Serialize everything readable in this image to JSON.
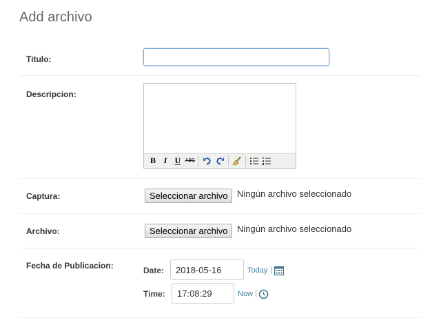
{
  "page": {
    "title": "Add archivo"
  },
  "fields": {
    "titulo": {
      "label": "Titulo:",
      "value": ""
    },
    "descripcion": {
      "label": "Descripcion:",
      "toolbar": {
        "bold": "B",
        "italic": "I",
        "underline": "U",
        "strikethrough": "ABC"
      }
    },
    "captura": {
      "label": "Captura:",
      "button_label": "Seleccionar archivo",
      "status": "Ningún archivo seleccionado"
    },
    "archivo": {
      "label": "Archivo:",
      "button_label": "Seleccionar archivo",
      "status": "Ningún archivo seleccionado"
    },
    "fecha_publicacion": {
      "label": "Fecha de Publicacion:",
      "date_label": "Date:",
      "date_value": "2018-05-16",
      "today_link": "Today",
      "time_label": "Time:",
      "time_value": "17:08:29",
      "now_link": "Now",
      "separator": "|"
    }
  },
  "colors": {
    "link": "#447e9b",
    "focus_border": "#7aa7d6"
  },
  "icons": [
    "bold-icon",
    "italic-icon",
    "underline-icon",
    "strikethrough-icon",
    "undo-icon",
    "redo-icon",
    "cleanup-icon",
    "bullet-list-icon",
    "numbered-list-icon",
    "calendar-icon",
    "clock-icon"
  ]
}
